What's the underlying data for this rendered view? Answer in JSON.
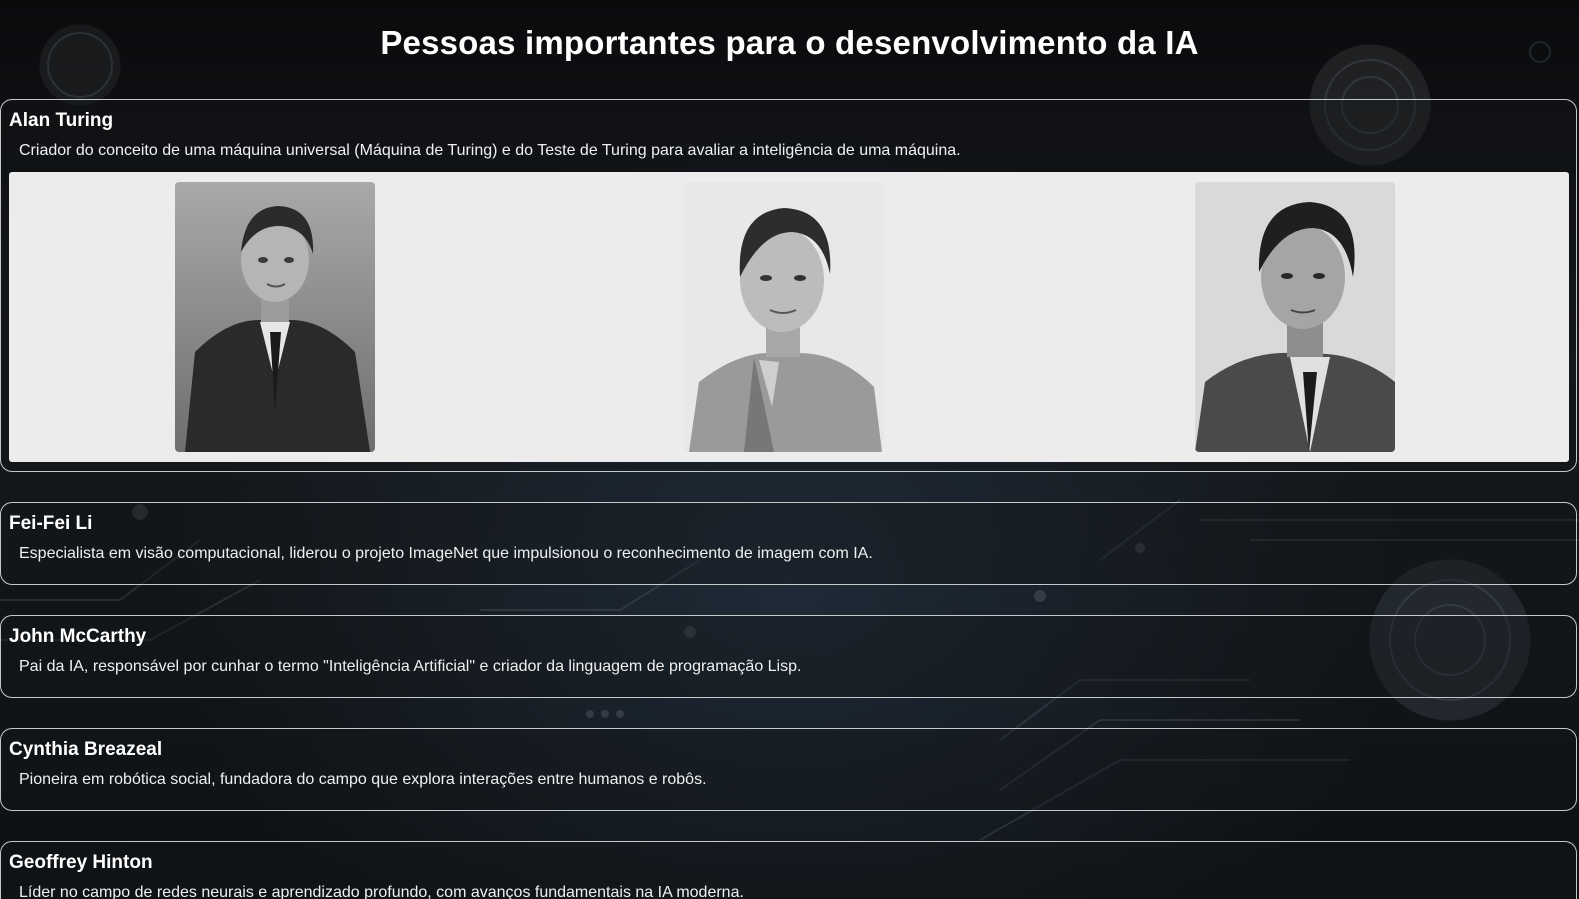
{
  "page": {
    "title": "Pessoas importantes para o desenvolvimento da IA"
  },
  "people": [
    {
      "name": "Alan Turing",
      "description": "Criador do conceito de uma máquina universal (Máquina de Turing) e do Teste de Turing para avaliar a inteligência de uma máquina.",
      "photos": [
        "alan-turing-photo-1",
        "alan-turing-photo-2",
        "alan-turing-photo-3"
      ]
    },
    {
      "name": "Fei-Fei Li",
      "description": "Especialista em visão computacional, liderou o projeto ImageNet que impulsionou o reconhecimento de imagem com IA."
    },
    {
      "name": "John McCarthy",
      "description": "Pai da IA, responsável por cunhar o termo \"Inteligência Artificial\" e criador da linguagem de programação Lisp."
    },
    {
      "name": "Cynthia Breazeal",
      "description": "Pioneira em robótica social, fundadora do campo que explora interações entre humanos e robôs."
    },
    {
      "name": "Geoffrey Hinton",
      "description": "Líder no campo de redes neurais e aprendizado profundo, com avanços fundamentais na IA moderna."
    }
  ],
  "colors": {
    "background": "#0b0d10",
    "card_border": "#e6e6e6",
    "gallery_background": "#ececec",
    "text": "#ffffff"
  }
}
